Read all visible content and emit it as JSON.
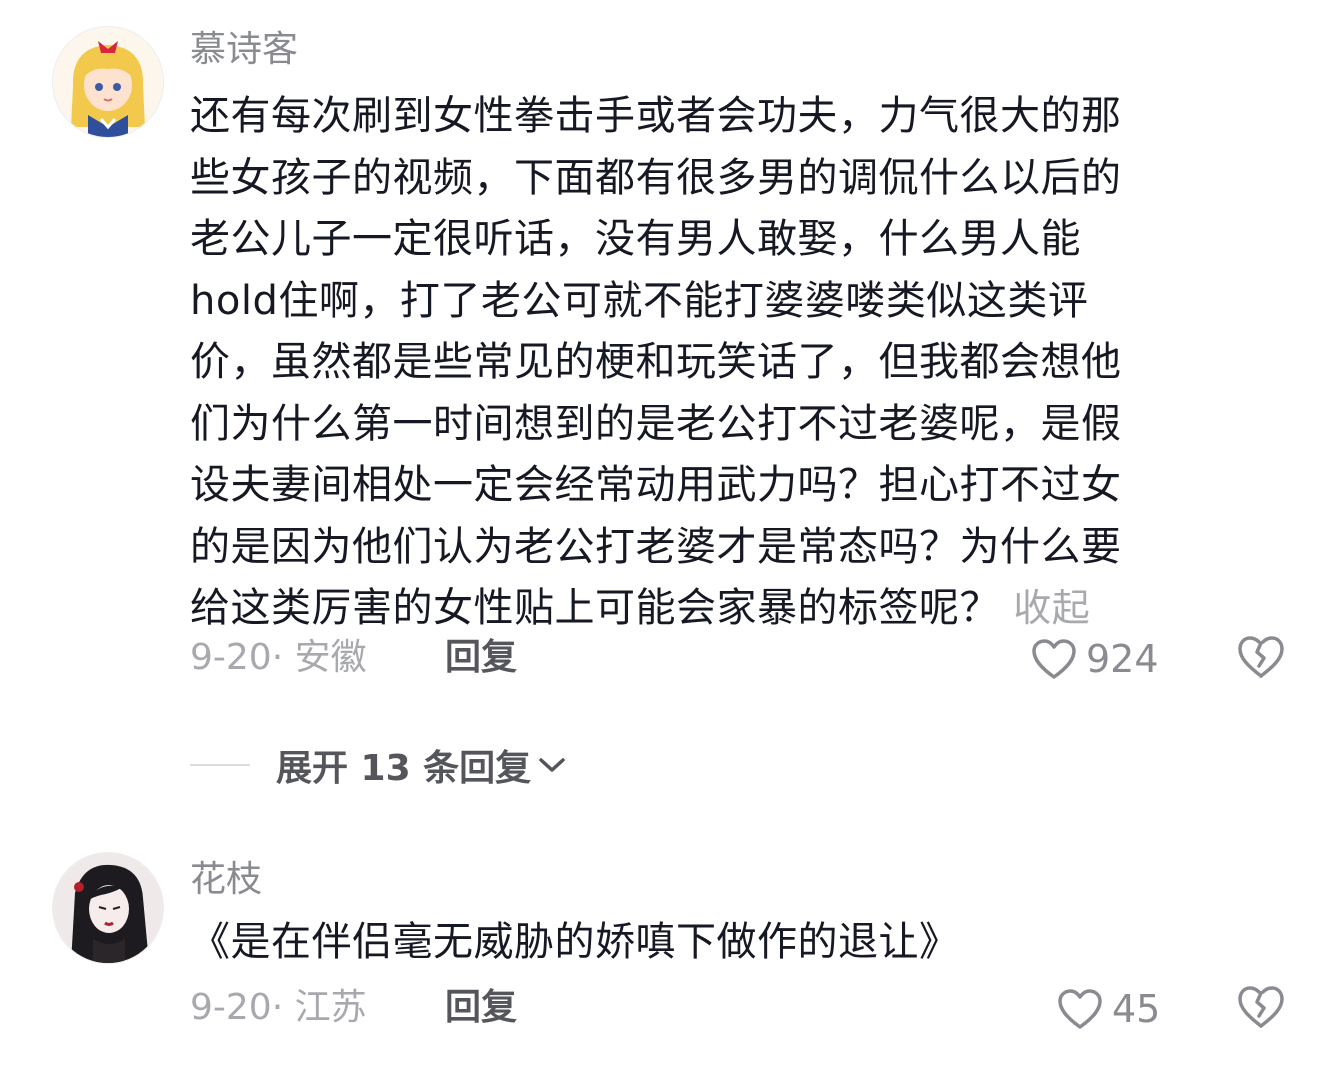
{
  "comments": [
    {
      "username": "慕诗客",
      "lines": [
        "还有每次刷到女性拳击手或者会功夫，力气很大的那",
        "些女孩子的视频，下面都有很多男的调侃什么以后的",
        "老公儿子一定很听话，没有男人敢娶，什么男人能",
        "hold住啊，打了老公可就不能打婆婆喽类似这类评",
        "价，虽然都是些常见的梗和玩笑话了，但我都会想他",
        "们为什么第一时间想到的是老公打不过老婆呢，是假",
        "设夫妻间相处一定会经常动用武力吗？担心打不过女",
        "的是因为他们认为老公打老婆才是常态吗？为什么要",
        "给这类厉害的女性贴上可能会家暴的标签呢？"
      ],
      "fold_label": "收起",
      "meta": "9-20· 安徽",
      "reply_label": "回复",
      "likes": "924"
    },
    {
      "username": "花枝",
      "lines": [
        "《是在伴侣毫无威胁的娇嗔下做作的退让》"
      ],
      "meta": "9-20· 江苏",
      "reply_label": "回复",
      "likes": "45"
    }
  ],
  "expand_replies_label": "展开 13 条回复",
  "icons": {
    "like": "heart-outline-icon",
    "dislike": "broken-heart-icon",
    "expand": "chevron-down-icon"
  },
  "colors": {
    "text": "#161823",
    "secondary": "#8a8b91",
    "muted": "#a8a9ae"
  }
}
